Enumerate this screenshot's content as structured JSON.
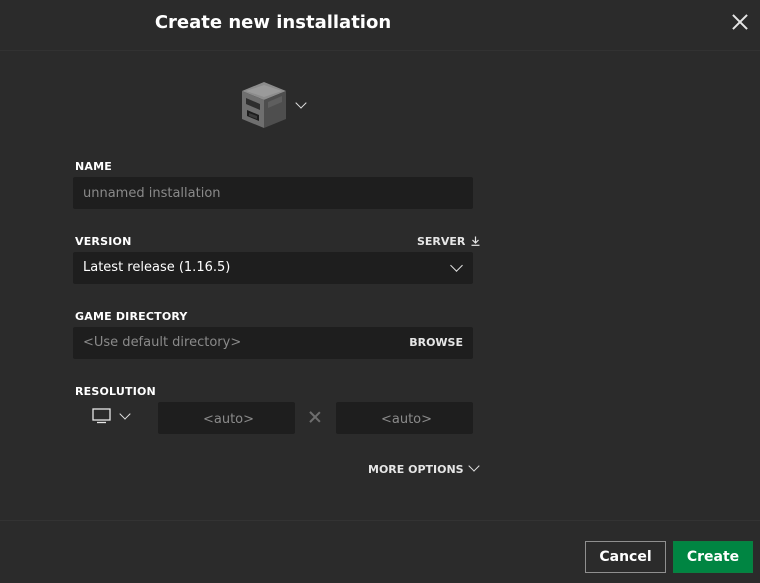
{
  "dialog": {
    "title": "Create new installation"
  },
  "name_field": {
    "label": "NAME",
    "placeholder": "unnamed installation",
    "value": ""
  },
  "version_field": {
    "label": "VERSION",
    "server_label": "SERVER",
    "selected": "Latest release (1.16.5)"
  },
  "directory_field": {
    "label": "GAME DIRECTORY",
    "placeholder": "<Use default directory>",
    "browse_label": "BROWSE"
  },
  "resolution": {
    "label": "RESOLUTION",
    "width_placeholder": "<auto>",
    "height_placeholder": "<auto>"
  },
  "more_options_label": "MORE OPTIONS",
  "footer": {
    "cancel_label": "Cancel",
    "create_label": "Create"
  },
  "icons": {
    "installation_icon": "furnace-block-icon",
    "close": "close-icon",
    "monitor": "monitor-icon",
    "download": "download-icon"
  },
  "colors": {
    "background": "#2b2b2b",
    "field_background": "#1e1e1e",
    "primary_button": "#008542"
  }
}
